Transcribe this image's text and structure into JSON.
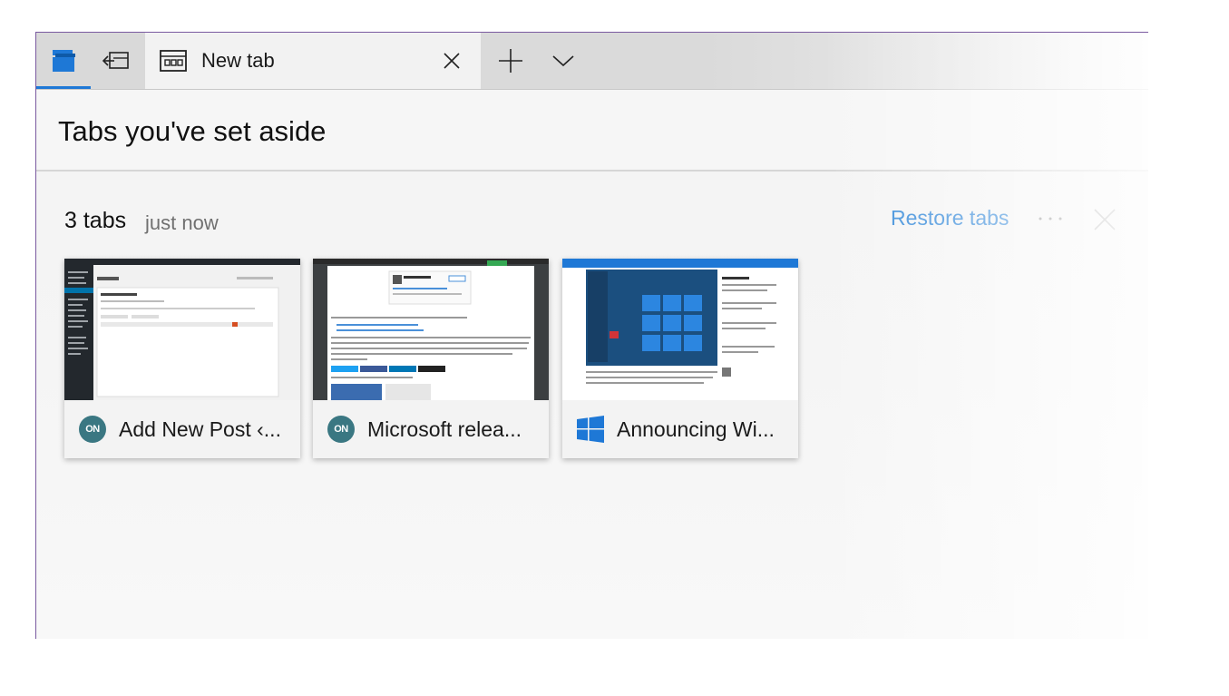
{
  "tabbar": {
    "tab_title": "New tab",
    "icons": {
      "tabs_aside": "tabs-set-aside-icon",
      "set_aside": "set-tabs-aside-icon",
      "tab": "new-tab-page-icon",
      "close": "close-icon",
      "new_tab": "plus-icon",
      "dropdown": "chevron-down-icon"
    },
    "accent_color": "#1e78d6"
  },
  "header": {
    "title": "Tabs you've set aside"
  },
  "group": {
    "count_label": "3 tabs",
    "time_label": "just now",
    "restore_label": "Restore tabs",
    "more_label": "···",
    "link_color": "#2f86d8",
    "tabs": [
      {
        "title": "Add New Post ‹...",
        "icon": "on-site-icon",
        "icon_text": "ON"
      },
      {
        "title": "Microsoft relea...",
        "icon": "on-site-icon",
        "icon_text": "ON"
      },
      {
        "title": "Announcing Wi...",
        "icon": "windows-logo-icon"
      }
    ]
  }
}
